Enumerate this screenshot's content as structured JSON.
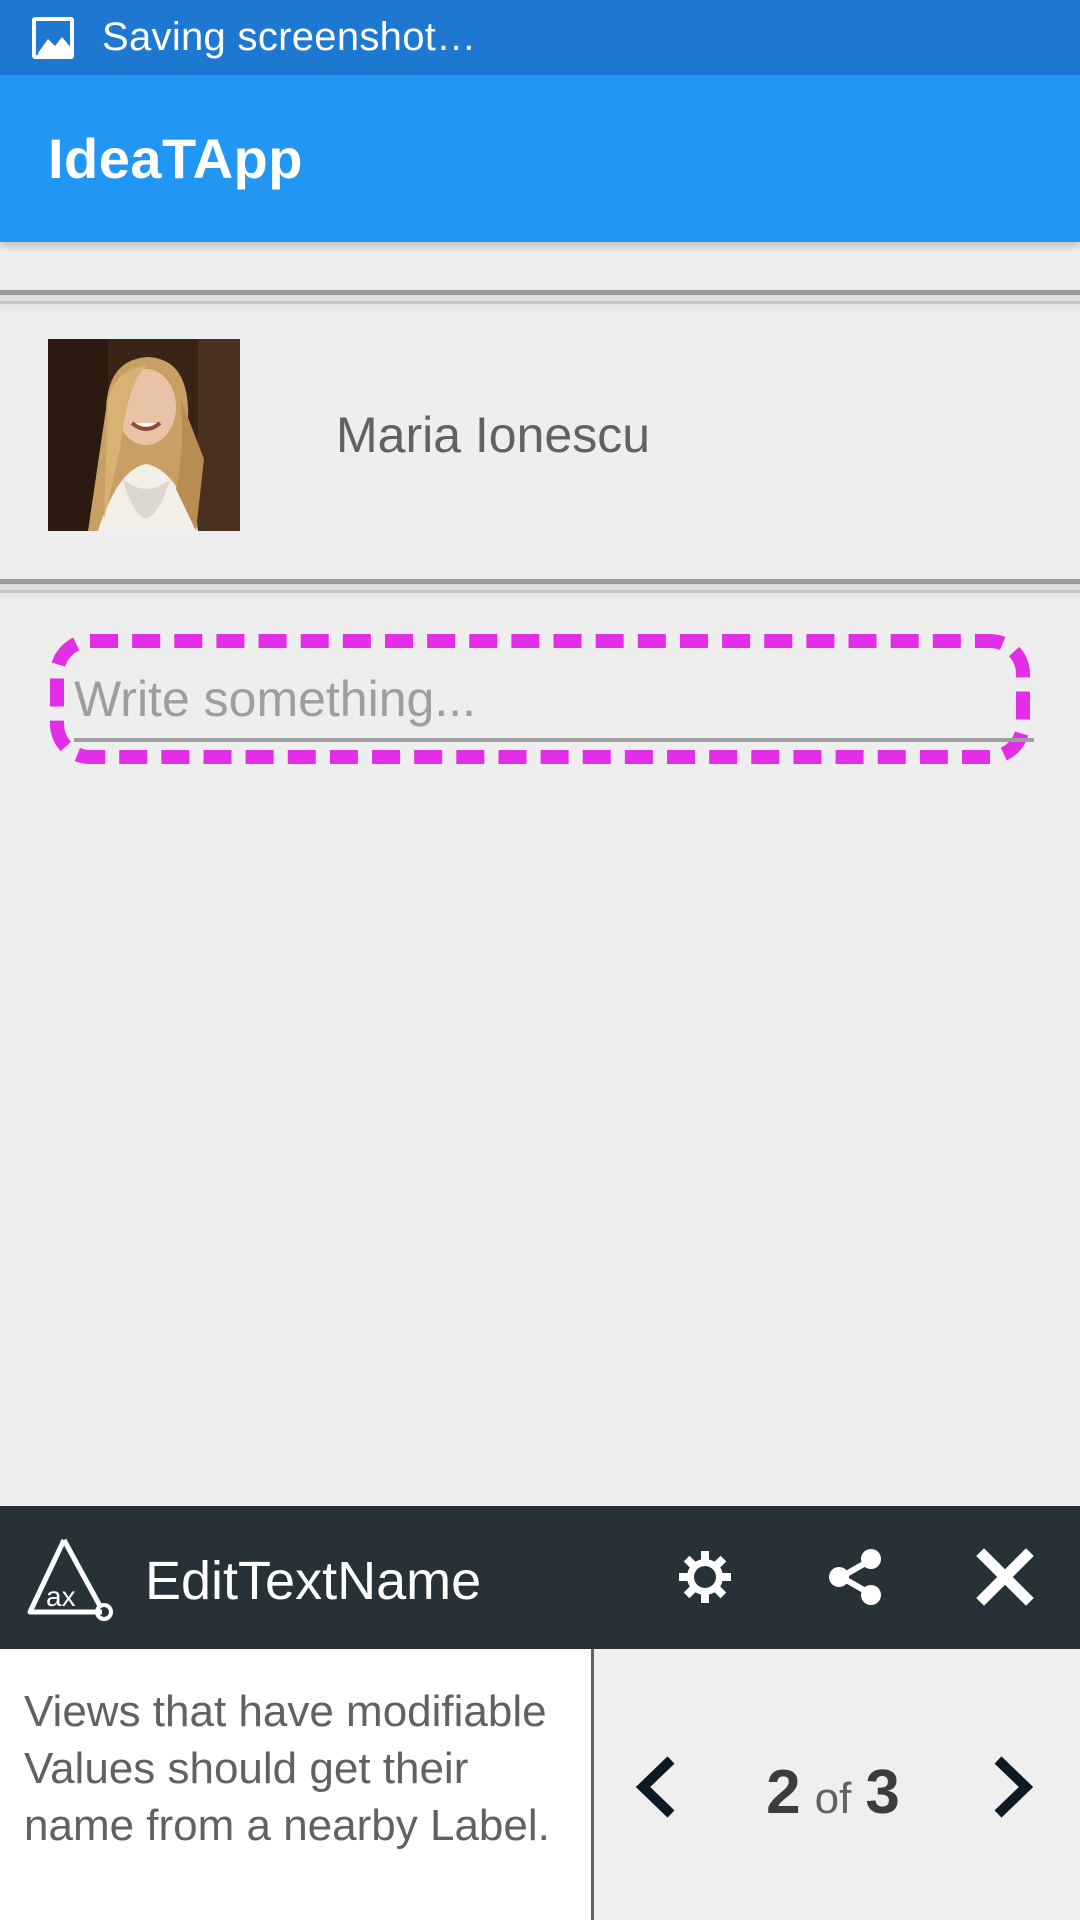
{
  "status_bar": {
    "icon": "image-icon",
    "text": "Saving screenshot…"
  },
  "app_bar": {
    "title": "IdeaTApp"
  },
  "profile": {
    "name": "Maria Ionescu",
    "avatar": "profile-photo"
  },
  "editor": {
    "placeholder": "Write something...",
    "value": "",
    "highlight_color": "#e32ee8"
  },
  "accessibility_panel": {
    "logo": "ax-logo-icon",
    "title": "EditTextName",
    "icons": [
      "gear-icon",
      "share-icon",
      "close-icon"
    ],
    "message": "Views that have modifiable Values should get their name from a nearby Label.",
    "pager": {
      "current": "2",
      "of_label": "of",
      "total": "3"
    }
  },
  "colors": {
    "status_bar": "#1e78d2",
    "app_bar": "#2196f3",
    "panel_header": "#263238",
    "background": "#eeeeee"
  }
}
